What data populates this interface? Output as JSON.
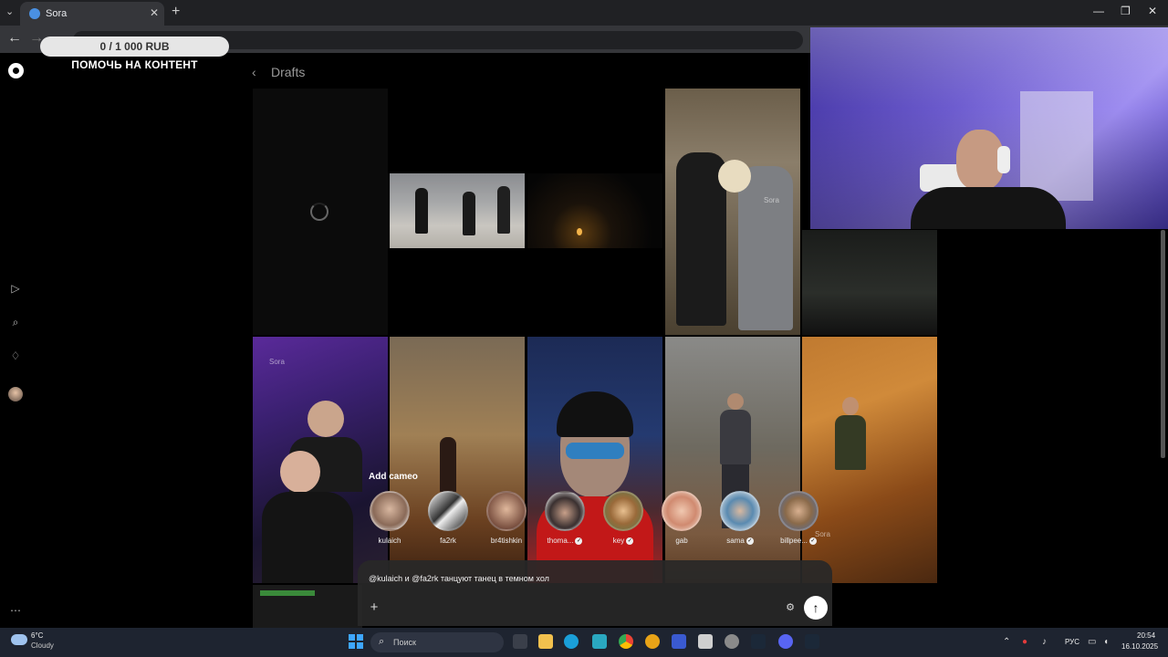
{
  "browser": {
    "tab_title": "Sora",
    "window_controls": [
      "—",
      "❐",
      "✕"
    ]
  },
  "donation": {
    "progress_text": "0 / 1 000 RUB",
    "label": "ПОМОЧЬ НА КОНТЕНТ",
    "progress_fraction": 0
  },
  "drafts": {
    "title": "Drafts"
  },
  "watermark": "Sora",
  "cameo_popup": {
    "title": "Add cameo",
    "cameos": [
      {
        "name": "kulaich",
        "verified": false
      },
      {
        "name": "fa2rk",
        "verified": false
      },
      {
        "name": "br4tishkin",
        "verified": false
      },
      {
        "name": "thoma...",
        "verified": true
      },
      {
        "name": "key",
        "verified": true
      },
      {
        "name": "gab",
        "verified": false
      },
      {
        "name": "sama",
        "verified": true
      },
      {
        "name": "billpee...",
        "verified": true
      }
    ]
  },
  "prompt": {
    "text": "@kulaich и @fa2rk танцуют танец в темном хол"
  },
  "taskbar": {
    "weather_temp": "6°C",
    "weather_desc": "Cloudy",
    "search_placeholder": "Поиск",
    "language": "РУС",
    "time": "20:54",
    "date": "16.10.2025"
  },
  "colors": {
    "accent": "#3ea6ff",
    "background": "#000000"
  }
}
